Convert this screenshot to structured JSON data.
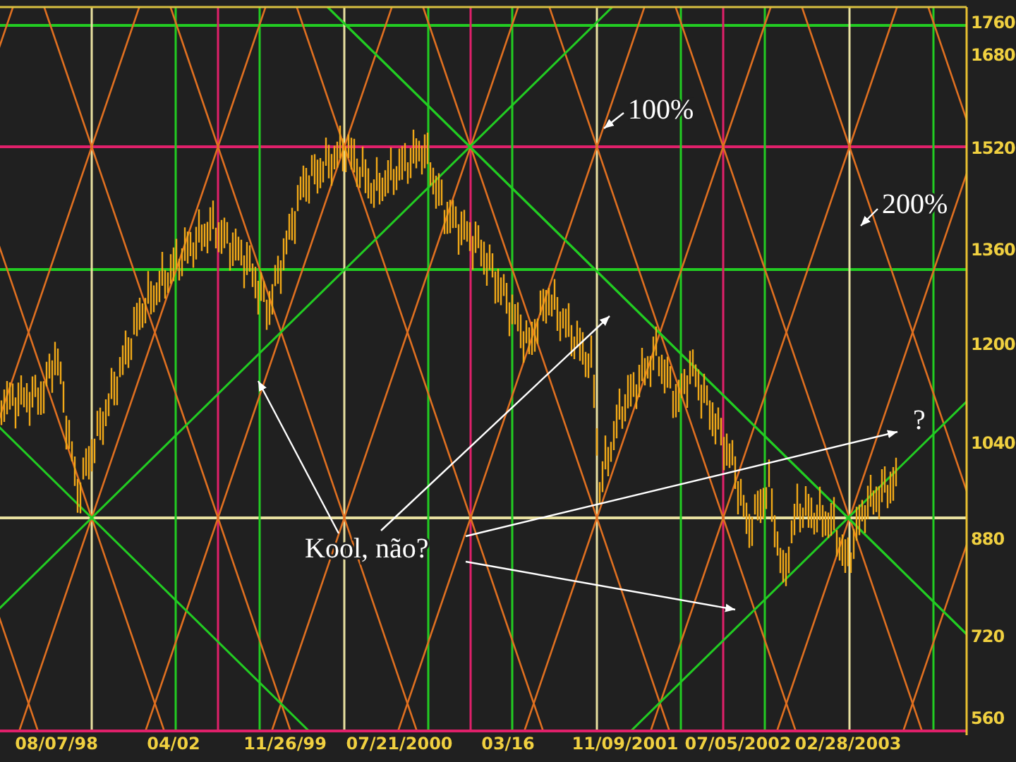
{
  "chart": {
    "y_axis_labels": [
      "1760",
      "1680",
      "1520",
      "1360",
      "1200",
      "1040",
      "880",
      "720",
      "560"
    ],
    "x_axis_labels": [
      "08/07/98",
      "04/02",
      "11/26/99",
      "07/21/2000",
      "03/16",
      "11/09/2001",
      "07/05/2002",
      "02/28/2003"
    ],
    "annotations": [
      {
        "text": "100%"
      },
      {
        "text": "200%"
      },
      {
        "text": "?"
      },
      {
        "text": "Kool, não?"
      }
    ]
  }
}
